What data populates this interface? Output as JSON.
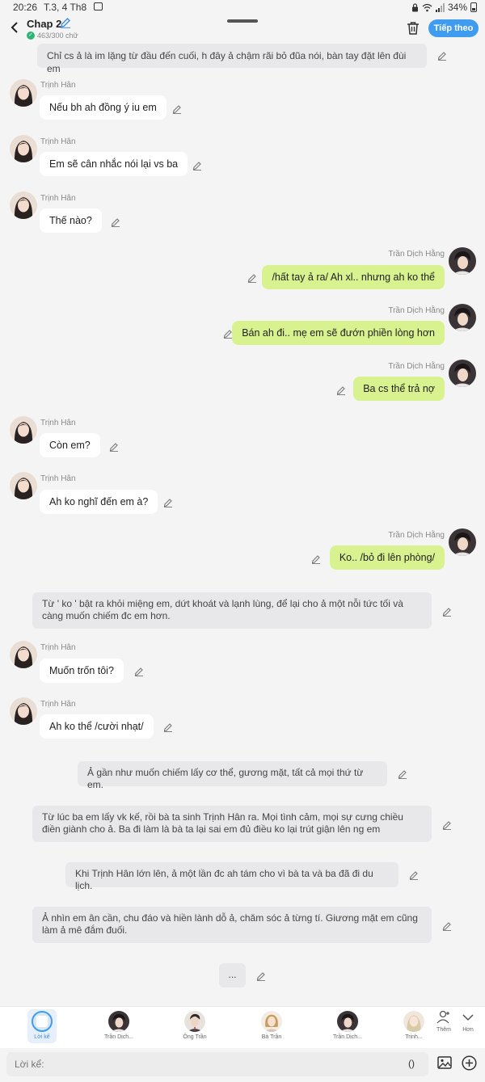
{
  "status": {
    "time": "20:26",
    "date": "T.3, 4 Th8",
    "battery": "34%"
  },
  "header": {
    "title": "Chap 2",
    "counter": "463/300 chữ",
    "next_label": "Tiếp theo"
  },
  "messages": [
    {
      "kind": "narration",
      "text": "Chỉ cs ả là im lặng từ đầu đến cuối, h đây ả chậm rãi bỏ đũa nói, bàn tay đặt lên đùi em"
    },
    {
      "kind": "left",
      "name": "Trịnh Hân",
      "text": "Nếu bh ah đồng ý iu em"
    },
    {
      "kind": "left",
      "name": "Trịnh Hân",
      "text": "Em sẽ cân nhắc nói lại vs ba"
    },
    {
      "kind": "left",
      "name": "Trịnh Hân",
      "text": "Thế nào?"
    },
    {
      "kind": "right",
      "name": "Trần Dịch Hằng",
      "text": "/hất tay ả ra/ Ah xl.. nhưng ah ko thể"
    },
    {
      "kind": "right",
      "name": "Trần Dịch Hằng",
      "text": "Bán ah đi.. mẹ em sẽ đướn phiền lòng hơn"
    },
    {
      "kind": "right",
      "name": "Trần Dịch Hằng",
      "text": "Ba cs thể trả nợ"
    },
    {
      "kind": "left",
      "name": "Trịnh Hân",
      "text": "Còn em?"
    },
    {
      "kind": "left",
      "name": "Trịnh Hân",
      "text": "Ah ko nghĩ đến em à?"
    },
    {
      "kind": "right",
      "name": "Trần Dịch Hằng",
      "text": "Ko.. /bỏ đi lên phòng/"
    },
    {
      "kind": "narration",
      "text": "Từ ' ko ' bật ra khỏi miệng em, dứt khoát và lạnh lùng, để lại cho ả một nỗi tức tối và càng muốn chiếm đc em hơn."
    },
    {
      "kind": "left",
      "name": "Trịnh Hân",
      "text": "Muốn trốn tôi?"
    },
    {
      "kind": "left",
      "name": "Trịnh Hân",
      "text": "Ah ko thể /cười nhạt/"
    },
    {
      "kind": "narration",
      "text": "Ả gần như muốn chiếm lấy cơ thể, gương mặt, tất cả mọi thứ từ em."
    },
    {
      "kind": "narration",
      "text": "Từ lúc ba em lấy vk kế, rồi bà ta sinh Trịnh Hân ra. Mọi tình cảm, mọi sự cưng chiều điền giành cho ả. Ba đi làm là bà ta lại sai em đủ điều ko lại trút giận lên ng em"
    },
    {
      "kind": "narration",
      "text": "Khi Trịnh Hân lớn lên, ả một lần đc ah tám cho vì bà ta và ba đã đi du lịch."
    },
    {
      "kind": "narration",
      "text": "Ả nhìn em ân cần, chu đáo và hiền lành dỗ ả, chăm sóc ả từng tí. Giương mặt em cũng làm ả mê đắm đuối."
    },
    {
      "kind": "narration",
      "text": "..."
    }
  ],
  "characters": [
    {
      "label": "Lời kể"
    },
    {
      "label": "Trần Dịch..."
    },
    {
      "label": "Ông Trần"
    },
    {
      "label": "Bà Trần"
    },
    {
      "label": "Trần Dịch..."
    },
    {
      "label": "Trịnh..."
    }
  ],
  "side_buttons": {
    "more": "Thêm",
    "less": "Hơn"
  },
  "input": {
    "placeholder": "Lời kể:",
    "paren": "()"
  },
  "colors": {
    "accent": "#3f9cf0",
    "right_bubble": "#d7f28f",
    "left_bubble": "#ffffff",
    "narration": "#e8e8ea"
  }
}
